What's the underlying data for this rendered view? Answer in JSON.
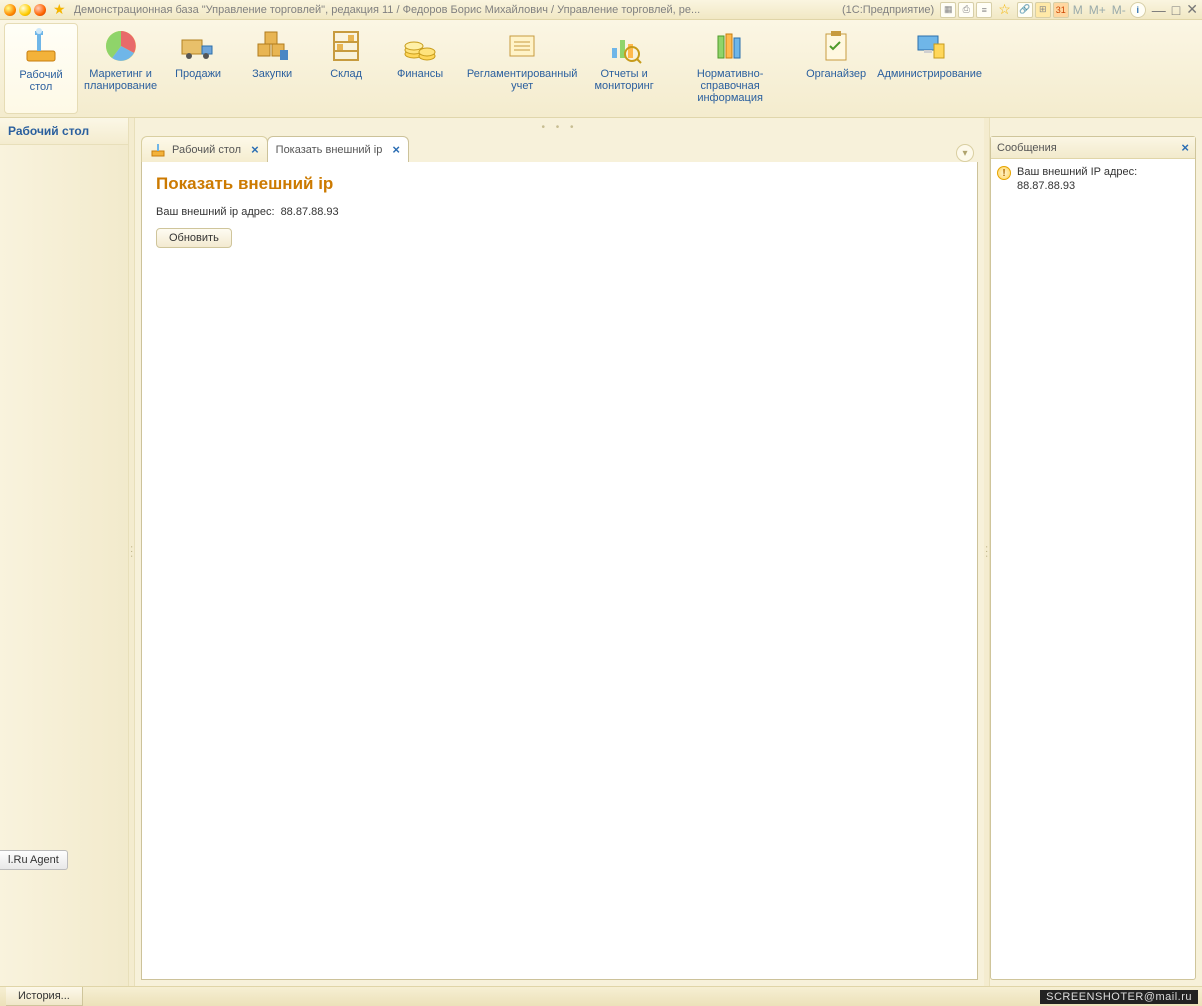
{
  "titlebar": {
    "title": "Демонстрационная база \"Управление торговлей\", редакция 11 / Федоров Борис Михайлович / Управление торговлей, ре...",
    "suffix": "(1С:Предприятие)",
    "m_labels": [
      "M",
      "M+",
      "M-"
    ]
  },
  "sections": [
    {
      "label": "Рабочий\nстол",
      "icon": "desk"
    },
    {
      "label": "Маркетинг и\nпланирование",
      "icon": "pie"
    },
    {
      "label": "Продажи",
      "icon": "truck"
    },
    {
      "label": "Закупки",
      "icon": "boxes"
    },
    {
      "label": "Склад",
      "icon": "shelf"
    },
    {
      "label": "Финансы",
      "icon": "coins"
    },
    {
      "label": "Регламентированный\nучет",
      "icon": "ledger"
    },
    {
      "label": "Отчеты и\nмониторинг",
      "icon": "chart"
    },
    {
      "label": "Нормативно-справочная\nинформация",
      "icon": "books"
    },
    {
      "label": "Органайзер",
      "icon": "clipboard"
    },
    {
      "label": "Администрирование",
      "icon": "pc"
    }
  ],
  "leftnav": {
    "header": "Рабочий стол"
  },
  "tabs": [
    {
      "label": "Рабочий стол",
      "active": false,
      "icon": "desk-sm"
    },
    {
      "label": "Показать внешний ip",
      "active": true,
      "icon": null
    }
  ],
  "page": {
    "title": "Показать внешний ip",
    "label": "Ваш внешний ip адрес:",
    "value": "88.87.88.93",
    "refresh_btn": "Обновить"
  },
  "messages": {
    "header": "Сообщения",
    "items": [
      {
        "text": "Ваш внешний IP адрес: 88.87.88.93"
      }
    ]
  },
  "status": {
    "history": "История..."
  },
  "agent_tab": "l.Ru Agent",
  "watermark": "SCREENSHOTER@mail.ru"
}
